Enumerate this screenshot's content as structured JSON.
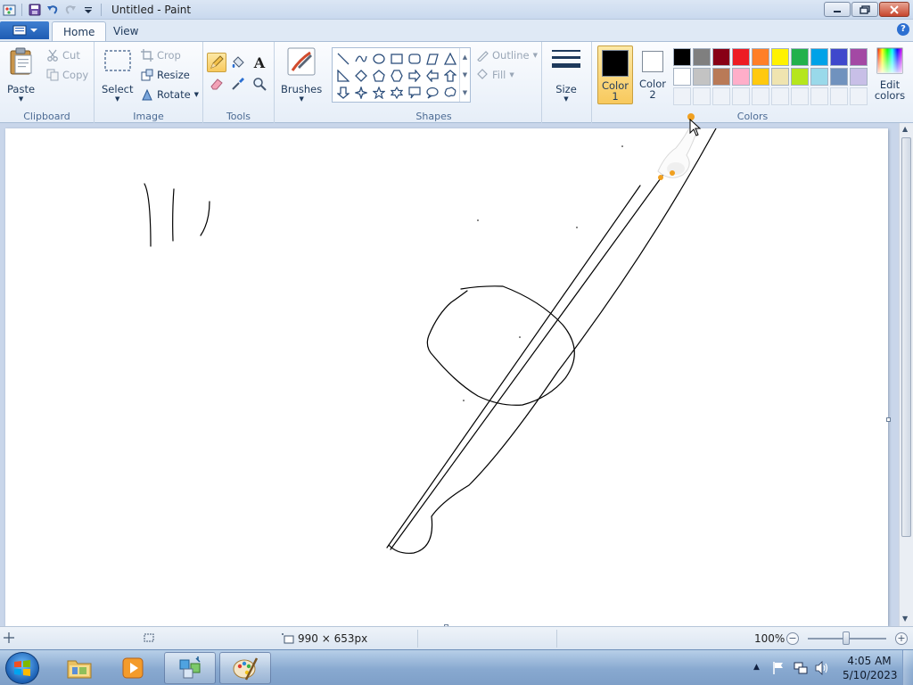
{
  "window": {
    "title": "Untitled - Paint",
    "qat_icons": [
      "save-icon",
      "undo-icon",
      "redo-icon",
      "customize-arrow-icon"
    ]
  },
  "tabs": [
    {
      "label": "Home",
      "active": true
    },
    {
      "label": "View",
      "active": false
    }
  ],
  "ribbon": {
    "clipboard": {
      "paste": "Paste",
      "cut": "Cut",
      "copy": "Copy",
      "label": "Clipboard"
    },
    "image": {
      "select": "Select",
      "crop": "Crop",
      "resize": "Resize",
      "rotate": "Rotate",
      "label": "Image"
    },
    "tools": {
      "label": "Tools",
      "items": [
        "pencil-icon",
        "fill-icon",
        "text-icon",
        "eraser-icon",
        "color-picker-icon",
        "magnifier-icon"
      ]
    },
    "brushes": {
      "label": "Brushes"
    },
    "shapes": {
      "label": "Shapes",
      "outline": "Outline",
      "fill": "Fill"
    },
    "size": {
      "label": "Size"
    },
    "colors": {
      "label": "Colors",
      "color1_label_line1": "Color",
      "color1_label_line2": "1",
      "color2_label_line1": "Color",
      "color2_label_line2": "2",
      "color1": "#000000",
      "color2": "#ffffff",
      "edit_line1": "Edit",
      "edit_line2": "colors",
      "palette_row1": [
        "#000000",
        "#7f7f7f",
        "#880015",
        "#ed1c24",
        "#ff7f27",
        "#fff200",
        "#22b14c",
        "#00a2e8",
        "#3f48cc",
        "#a349a4"
      ],
      "palette_row2": [
        "#ffffff",
        "#c3c3c3",
        "#b97a57",
        "#ffaec9",
        "#ffc90e",
        "#efe4b0",
        "#b5e61d",
        "#99d9ea",
        "#7092be",
        "#c8bfe7"
      ]
    }
  },
  "status": {
    "canvas_size": "990 × 653px",
    "zoom": "100%"
  },
  "taskbar": {
    "time": "4:05 AM",
    "date": "5/10/2023",
    "items": [
      "explorer-icon",
      "media-player-icon",
      "network-app-icon",
      "paint-icon"
    ]
  }
}
